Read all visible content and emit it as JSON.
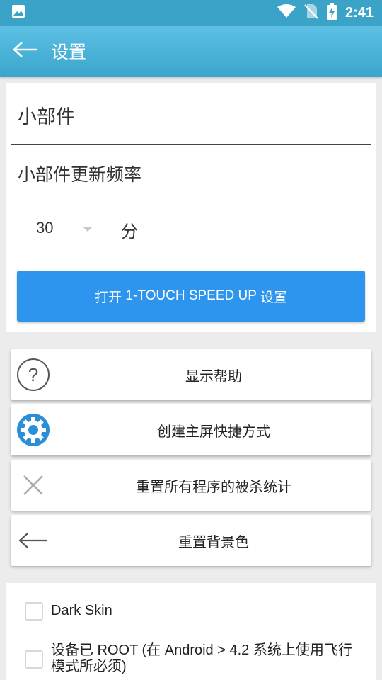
{
  "status_bar": {
    "time": "2:41",
    "icons": [
      "image-icon",
      "wifi-icon",
      "no-sim-icon",
      "battery-charging-icon"
    ]
  },
  "app_bar": {
    "title": "设置",
    "back_icon": "arrow-left-icon"
  },
  "widget_section": {
    "title": "小部件",
    "update_freq_label": "小部件更新频率",
    "freq_value": "30",
    "freq_unit": "分",
    "open_button_prefix": "打开",
    "open_button_middle": " 1-TOUCH SPEED UP ",
    "open_button_suffix": "设置"
  },
  "actions": [
    {
      "label": "显示帮助",
      "icon": "help-circle-icon"
    },
    {
      "label": "创建主屏快捷方式",
      "icon": "gear-shortcut-icon"
    },
    {
      "label": "重置所有程序的被杀统计",
      "icon": "close-x-icon"
    },
    {
      "label": "重置背景色",
      "icon": "arrow-left-icon"
    }
  ],
  "options": [
    {
      "label": "Dark Skin",
      "checked": false
    },
    {
      "label": "设备已 ROOT (在 Android > 4.2 系统上使用飞行模式所必须)",
      "checked": false
    }
  ],
  "colors": {
    "status_bar": "#3aa3c7",
    "app_bar": "#4fb5db",
    "primary_button": "#2d95ed",
    "background": "#ececec"
  }
}
